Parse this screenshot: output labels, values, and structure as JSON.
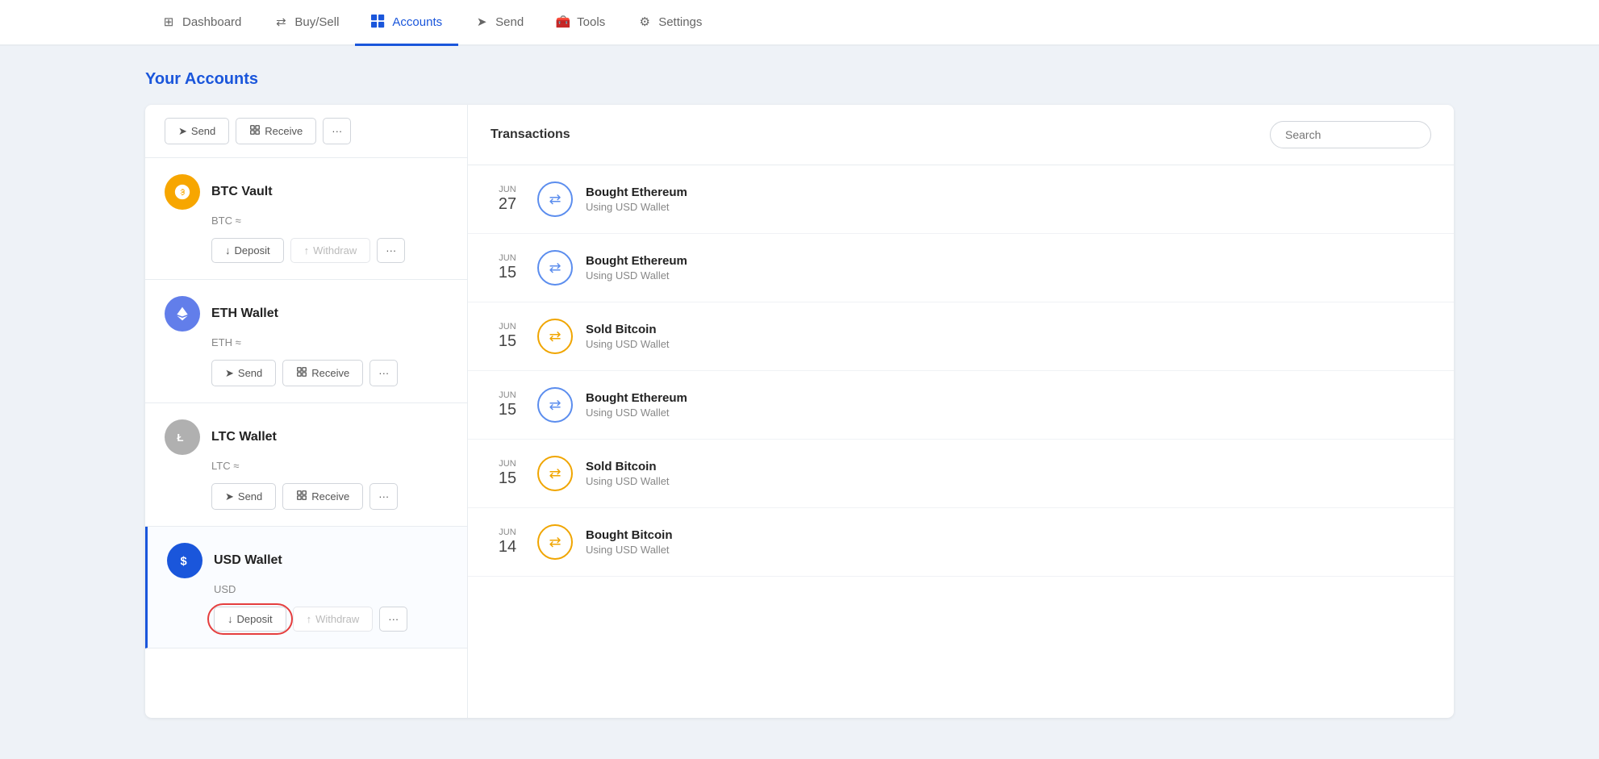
{
  "nav": {
    "items": [
      {
        "id": "dashboard",
        "label": "Dashboard",
        "icon": "⊞",
        "active": false
      },
      {
        "id": "buysell",
        "label": "Buy/Sell",
        "icon": "⇄",
        "active": false
      },
      {
        "id": "accounts",
        "label": "Accounts",
        "icon": "📋",
        "active": true
      },
      {
        "id": "send",
        "label": "Send",
        "icon": "➤",
        "active": false
      },
      {
        "id": "tools",
        "label": "Tools",
        "icon": "🧰",
        "active": false
      },
      {
        "id": "settings",
        "label": "Settings",
        "icon": "⚙",
        "active": false
      }
    ]
  },
  "page": {
    "title": "Your Accounts"
  },
  "accounts": [
    {
      "id": "btc-vault",
      "name": "BTC Vault",
      "currency": "BTC ≈",
      "icon_type": "btc",
      "active": false,
      "buttons": [
        "Deposit",
        "Withdraw",
        "..."
      ]
    },
    {
      "id": "eth-wallet",
      "name": "ETH Wallet",
      "currency": "ETH ≈",
      "icon_type": "eth",
      "active": false,
      "buttons": [
        "Send",
        "Receive",
        "..."
      ]
    },
    {
      "id": "ltc-wallet",
      "name": "LTC Wallet",
      "currency": "LTC ≈",
      "icon_type": "ltc",
      "active": false,
      "buttons": [
        "Send",
        "Receive",
        "..."
      ]
    },
    {
      "id": "usd-wallet",
      "name": "USD Wallet",
      "currency": "USD",
      "icon_type": "usd",
      "active": true,
      "buttons": [
        "Deposit",
        "Withdraw",
        "..."
      ]
    }
  ],
  "transactions": {
    "title": "Transactions",
    "search_placeholder": "Search",
    "items": [
      {
        "month": "JUN",
        "day": "27",
        "name": "Bought Ethereum",
        "sub": "Using USD Wallet",
        "icon_color": "blue"
      },
      {
        "month": "JUN",
        "day": "15",
        "name": "Bought Ethereum",
        "sub": "Using USD Wallet",
        "icon_color": "blue"
      },
      {
        "month": "JUN",
        "day": "15",
        "name": "Sold Bitcoin",
        "sub": "Using USD Wallet",
        "icon_color": "orange"
      },
      {
        "month": "JUN",
        "day": "15",
        "name": "Bought Ethereum",
        "sub": "Using USD Wallet",
        "icon_color": "blue"
      },
      {
        "month": "JUN",
        "day": "15",
        "name": "Sold Bitcoin",
        "sub": "Using USD Wallet",
        "icon_color": "orange"
      },
      {
        "month": "JUN",
        "day": "14",
        "name": "Bought Bitcoin",
        "sub": "Using USD Wallet",
        "icon_color": "orange"
      }
    ]
  },
  "labels": {
    "send": "Send",
    "receive": "Receive",
    "deposit": "Deposit",
    "withdraw": "Withdraw",
    "more": "···"
  }
}
